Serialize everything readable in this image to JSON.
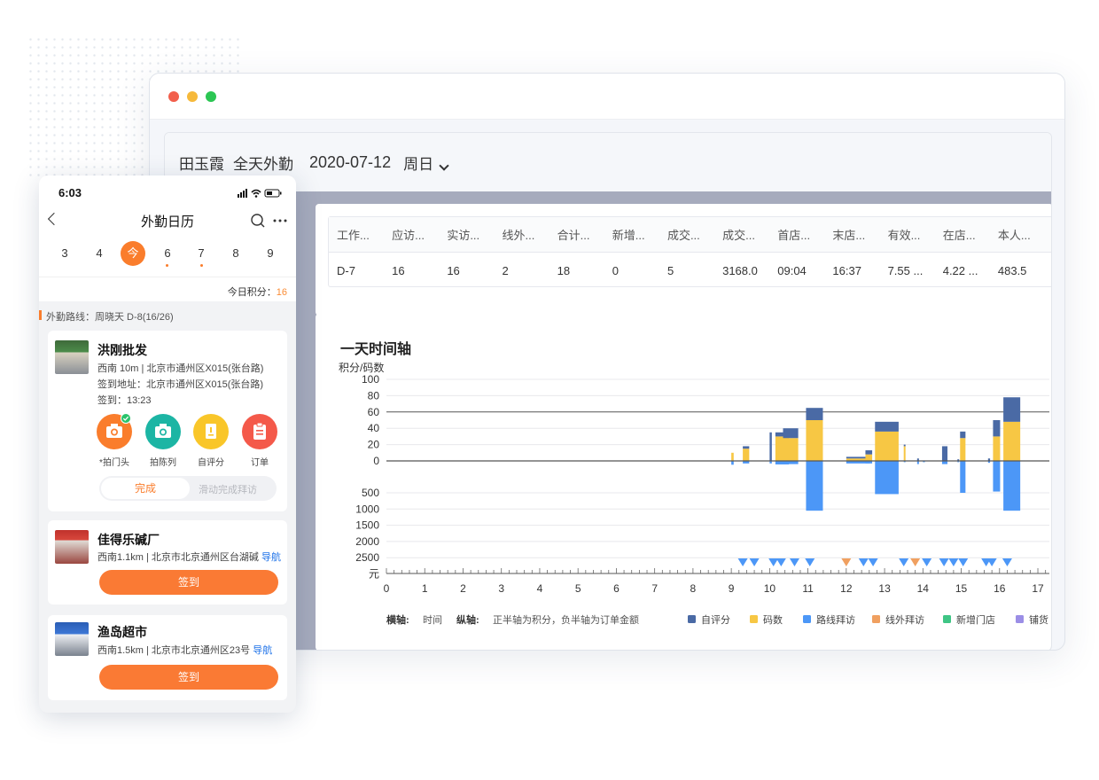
{
  "desktop": {
    "employee": "田玉霞",
    "shift": "全天外勤",
    "date": "2020-07-12",
    "weekday": "周日",
    "table": {
      "headers": [
        "工作...",
        "应访...",
        "实访...",
        "线外...",
        "合计...",
        "新增...",
        "成交...",
        "成交...",
        "首店...",
        "末店...",
        "有效...",
        "在店...",
        "本人..."
      ],
      "row": [
        "D-7",
        "16",
        "16",
        "2",
        "18",
        "0",
        "5",
        "3168.0",
        "09:04",
        "16:37",
        "7.55 ...",
        "4.22 ...",
        "483.5"
      ]
    },
    "chart_title": "一天时间轴",
    "y_label": "积分/码数",
    "y_unit": "元",
    "footer": {
      "x_axis_key": "横轴:",
      "x_axis_val": "时间",
      "y_axis_key": "纵轴:",
      "y_axis_val": "正半轴为积分，负半轴为订单金额"
    }
  },
  "chart_data": {
    "type": "bar",
    "title": "一天时间轴",
    "ylabel": "积分/码数",
    "ylim_positive": [
      0,
      100
    ],
    "positive_ticks": [
      "100",
      "80",
      "60",
      "40",
      "20",
      "0"
    ],
    "negative_ticks": [
      "500",
      "1000",
      "1500",
      "2000",
      "2500"
    ],
    "negative_unit": "元",
    "x_ticks": [
      "0",
      "1",
      "2",
      "3",
      "4",
      "5",
      "6",
      "7",
      "8",
      "9",
      "10",
      "11",
      "12",
      "13",
      "14",
      "15",
      "16",
      "17"
    ],
    "xlim": [
      0,
      17.3
    ],
    "legend": [
      {
        "name": "自评分",
        "color": "#4a6aa5"
      },
      {
        "name": "码数",
        "color": "#f7c744"
      },
      {
        "name": "路线拜访",
        "color": "#4c97f7"
      },
      {
        "name": "线外拜访",
        "color": "#f0a060"
      },
      {
        "name": "新增门店",
        "color": "#3fc585"
      },
      {
        "name": "铺货",
        "color": "#9b8ee6"
      }
    ],
    "bars": [
      {
        "x": 9.0,
        "w": 0.14,
        "self": 0,
        "code": 10,
        "order": 60
      },
      {
        "x": 9.3,
        "w": 0.38,
        "self": 3,
        "code": 15,
        "order": 40
      },
      {
        "x": 10.0,
        "w": 0.13,
        "self": 35,
        "code": 0,
        "order": 40
      },
      {
        "x": 10.15,
        "w": 0.8,
        "self": 5,
        "code": 30,
        "order": 55
      },
      {
        "x": 10.35,
        "w": 0.9,
        "self": 12,
        "code": 28,
        "order": 50
      },
      {
        "x": 10.95,
        "w": 1.0,
        "self": 15,
        "code": 50,
        "order": 780
      },
      {
        "x": 12.0,
        "w": 1.4,
        "self": 2,
        "code": 3,
        "order": 40
      },
      {
        "x": 12.5,
        "w": 0.4,
        "self": 5,
        "code": 8,
        "order": 40
      },
      {
        "x": 12.75,
        "w": 1.4,
        "self": 12,
        "code": 36,
        "order": 520
      },
      {
        "x": 13.5,
        "w": 0.07,
        "self": 2,
        "code": 18,
        "order": 20
      },
      {
        "x": 13.85,
        "w": 0.07,
        "self": 3,
        "code": 0,
        "order": 50
      },
      {
        "x": 14.0,
        "w": 0.12,
        "self": 0,
        "code": 0,
        "order": 20
      },
      {
        "x": 14.5,
        "w": 0.32,
        "self": 18,
        "code": 0,
        "order": 50
      },
      {
        "x": 14.9,
        "w": 0.07,
        "self": 2,
        "code": 0,
        "order": 20
      },
      {
        "x": 14.97,
        "w": 0.32,
        "self": 8,
        "code": 28,
        "order": 500
      },
      {
        "x": 15.7,
        "w": 0.12,
        "self": 3,
        "code": 0,
        "order": 30
      },
      {
        "x": 15.83,
        "w": 0.42,
        "self": 20,
        "code": 30,
        "order": 480
      },
      {
        "x": 16.1,
        "w": 1.0,
        "self": 30,
        "code": 48,
        "order": 780
      }
    ],
    "visit_markers": [
      {
        "x": 9.3,
        "type": "路线拜访"
      },
      {
        "x": 9.6,
        "type": "路线拜访"
      },
      {
        "x": 10.1,
        "type": "路线拜访"
      },
      {
        "x": 10.3,
        "type": "路线拜访"
      },
      {
        "x": 10.65,
        "type": "路线拜访"
      },
      {
        "x": 11.05,
        "type": "路线拜访"
      },
      {
        "x": 12.0,
        "type": "线外拜访"
      },
      {
        "x": 12.45,
        "type": "路线拜访"
      },
      {
        "x": 12.7,
        "type": "路线拜访"
      },
      {
        "x": 13.5,
        "type": "路线拜访"
      },
      {
        "x": 13.8,
        "type": "线外拜访"
      },
      {
        "x": 14.1,
        "type": "路线拜访"
      },
      {
        "x": 14.55,
        "type": "路线拜访"
      },
      {
        "x": 14.8,
        "type": "路线拜访"
      },
      {
        "x": 15.05,
        "type": "路线拜访"
      },
      {
        "x": 15.65,
        "type": "路线拜访"
      },
      {
        "x": 15.8,
        "type": "路线拜访"
      },
      {
        "x": 16.2,
        "type": "路线拜访"
      }
    ]
  },
  "phone": {
    "time": "6:03",
    "title": "外勤日历",
    "days": [
      "3",
      "4",
      "今",
      "6",
      "7",
      "8",
      "9"
    ],
    "score_label": "今日积分：",
    "score_value": "16",
    "route": "外勤路线：周晓天 D-8(16/26)",
    "stores": [
      {
        "name": "洪刚批发",
        "line1": "西南 10m | 北京市通州区X015(张台路)",
        "line2": "签到地址：北京市通州区X015(张台路)",
        "line3": "签到：13:23",
        "actions": [
          "*拍门头",
          "拍陈列",
          "自评分",
          "订单"
        ],
        "done": "完成",
        "swipe_hint": "滑动完成拜访"
      },
      {
        "name": "佳得乐碱厂",
        "line1": "西南1.1km | 北京市北京通州区台湖碱",
        "nav": "导航",
        "button": "签到"
      },
      {
        "name": "渔岛超市",
        "line1": "西南1.5km | 北京市北京通州区23号",
        "nav": "导航",
        "button": "签到"
      }
    ]
  }
}
